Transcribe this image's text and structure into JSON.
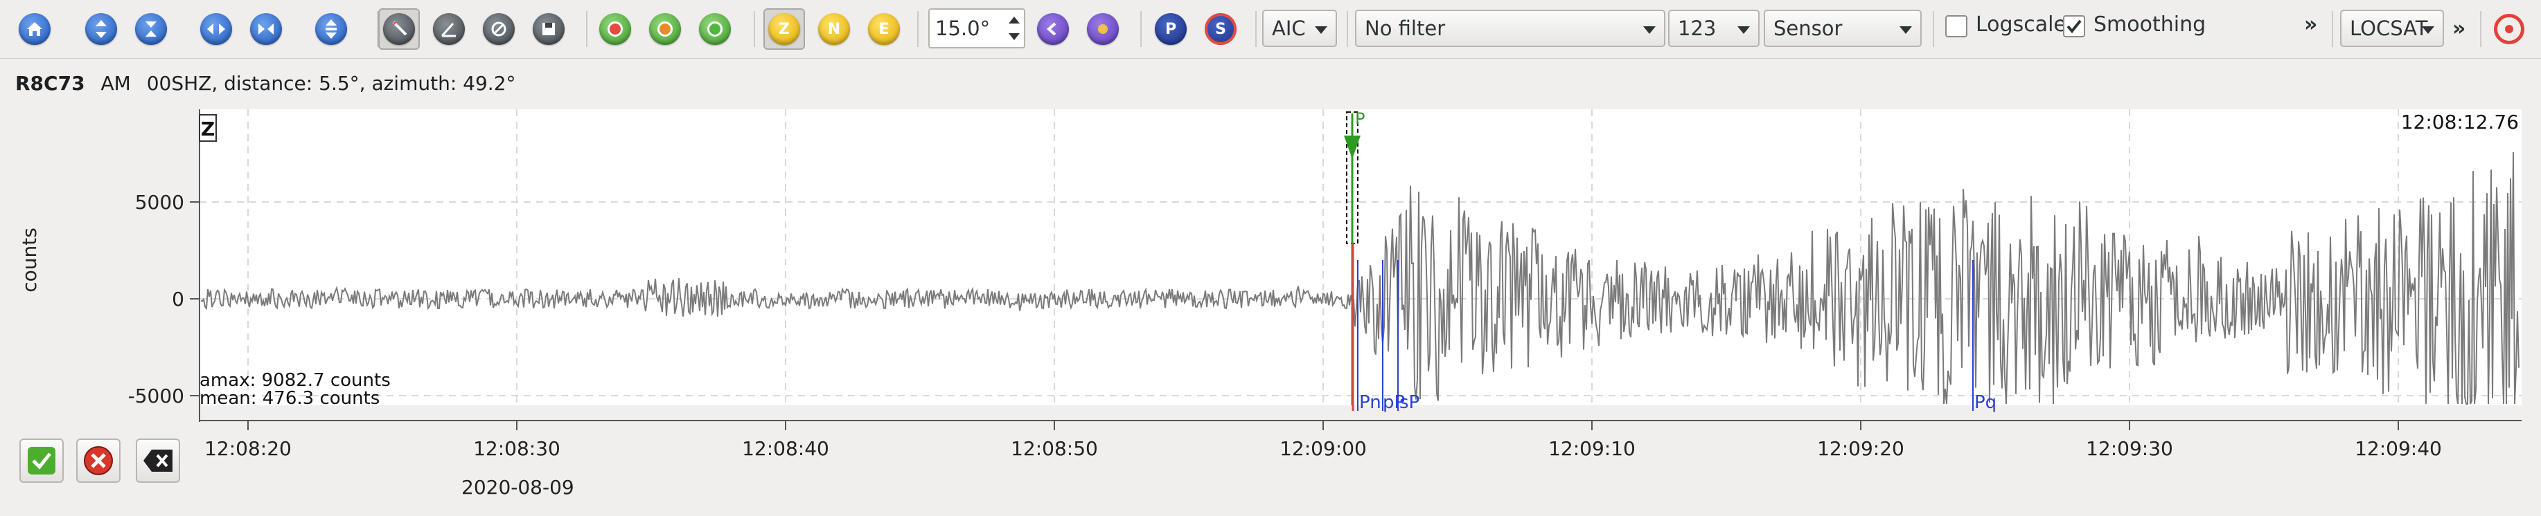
{
  "toolbar": {
    "view_buttons": [
      "home",
      "zoom-in-vertical",
      "zoom-out-vertical",
      "zoom-in-horizontal",
      "zoom-out-horizontal",
      "reset-vertical"
    ],
    "tool_buttons": [
      "pick-tool",
      "measure-tool",
      "filter-tool",
      "save-tool"
    ],
    "rotation_buttons": [
      "rotate-sensor",
      "rotate-zne",
      "rotate-lqt"
    ],
    "components": {
      "z": "Z",
      "n": "N",
      "e": "E"
    },
    "rotation_value": "15.0°",
    "phase_buttons": {
      "p": "P",
      "s": "S"
    },
    "picker_method": "AIC",
    "filter": "No filter",
    "units_value": "123",
    "units_mode": "Sensor",
    "logscale_label": "Logscale",
    "logscale_checked": false,
    "smoothing_label": "Smoothing",
    "smoothing_checked": true,
    "overflow_symbol": "»",
    "locator": "LOCSAT",
    "overflow2_symbol": "»"
  },
  "trace": {
    "station": "R8C73",
    "network": "AM",
    "channel": "00SHZ",
    "distance_text": "distance: 5.5°, azimuth: 49.2°",
    "component_label": "Z",
    "time_label": "12:08:12.76",
    "amax_text": "amax: 9082.7 counts",
    "mean_text": "mean: 476.3 counts",
    "y_unit": "counts",
    "y_ticks": [
      "5000",
      "0",
      "-5000"
    ],
    "x_ticks": [
      "12:08:20",
      "12:08:30",
      "12:08:40",
      "12:08:50",
      "12:09:00",
      "12:09:10",
      "12:09:20",
      "12:09:30",
      "12:09:40"
    ],
    "date_label": "2020-08-09",
    "picks": {
      "manual": "P",
      "theoretical": [
        "Pn",
        "pP",
        "sP",
        "Pq"
      ]
    }
  },
  "colors": {
    "accent_blue": "#2a3fd6",
    "pick_green": "#2f9a22",
    "pick_red": "#d9463b",
    "trace": "#7a7a7a"
  },
  "bottom_buttons": [
    "accept-button",
    "reject-button",
    "close-button"
  ]
}
